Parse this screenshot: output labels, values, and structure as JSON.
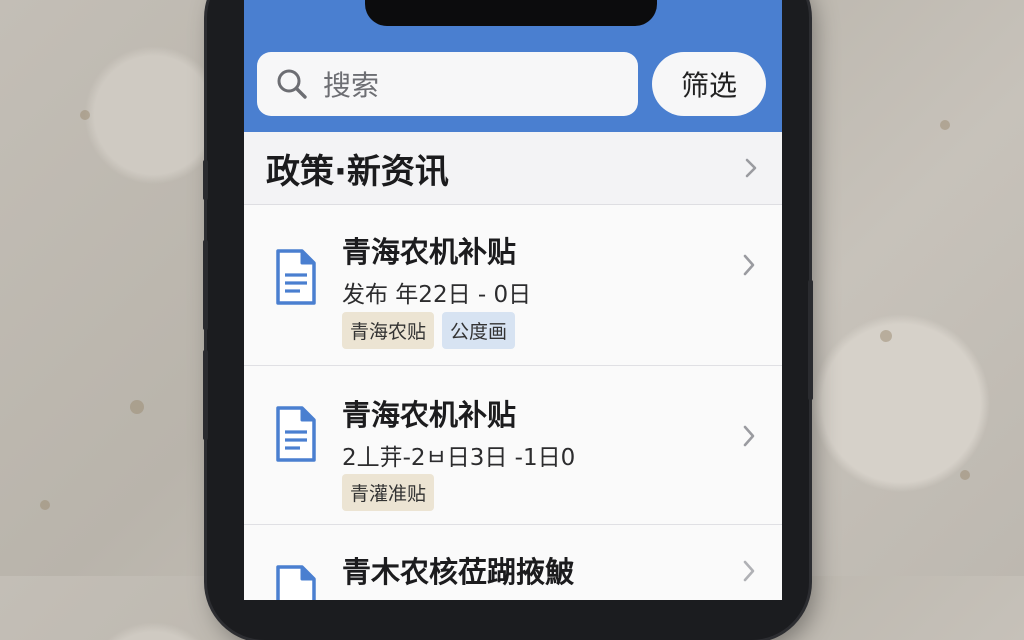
{
  "header": {
    "search_placeholder": "搜索",
    "filter_label": "筛选"
  },
  "section": {
    "title": "政策·新资讯"
  },
  "items": [
    {
      "title": "青海农机补贴",
      "meta": "发布 年22日 - 0日",
      "tags": [
        "青海农贴",
        "公度画"
      ]
    },
    {
      "title": "青海农机补贴",
      "meta": "2丄茾-2ㅂ日3日 -1日0",
      "tags": [
        "青灌准贴"
      ]
    },
    {
      "title": "青木农核莅䠒掖鮍",
      "meta": "",
      "tags": []
    }
  ],
  "colors": {
    "header_bg": "#4a7fd0",
    "icon_blue": "#4a7fd0",
    "tag_beige": "#ece4d3",
    "tag_blue": "#d7e3f2"
  }
}
